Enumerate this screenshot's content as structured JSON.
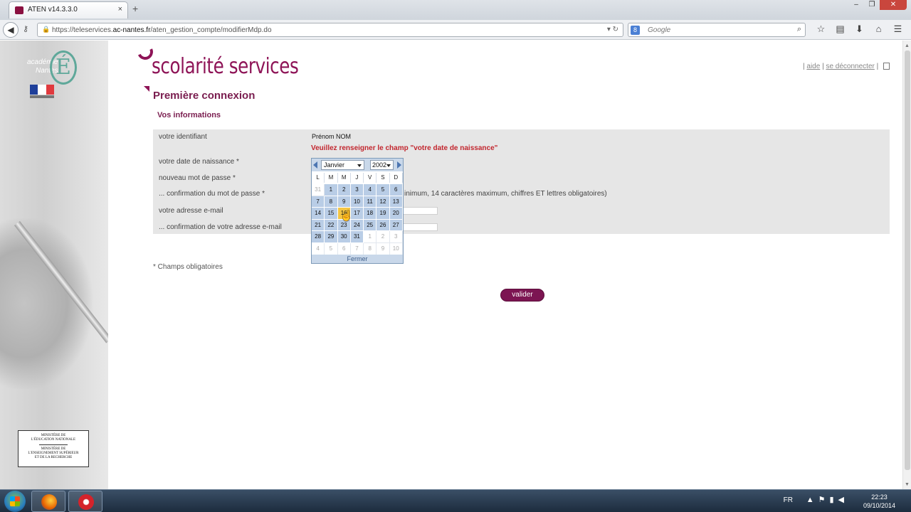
{
  "browser": {
    "tab_title": "ATEN v14.3.3.0",
    "tab_close": "×",
    "new_tab": "+",
    "url_prefix": "https://teleservices.",
    "url_domain": "ac-nantes.fr",
    "url_path": "/aten_gestion_compte/modifierMdp.do",
    "search_placeholder": "Google",
    "search_engine_letter": "8"
  },
  "sidebar": {
    "academie_line1": "académie",
    "academie_line2": "Nantes",
    "academie_letter": "É",
    "ministere_line1": "MINISTÈRE DE",
    "ministere_line2": "L'ÉDUCATION NATIONALE",
    "ministere_line3": "MINISTÈRE DE",
    "ministere_line4": "L'ENSEIGNEMENT SUPÉRIEUR",
    "ministere_line5": "ET DE LA RECHERCHE"
  },
  "header": {
    "logo_text": "scolarité services",
    "link_aide": "aide",
    "link_deconnecter": "se déconnecter"
  },
  "page": {
    "title": "Première connexion",
    "section_title": "Vos informations",
    "required_note": "* Champs obligatoires",
    "submit_label": "valider"
  },
  "form": {
    "identifiant_label": "votre identifiant",
    "identifiant_value": "Prénom NOM",
    "error_message": "Veuillez renseigner le champ \"votre date de naissance\"",
    "naissance_label": "votre date de naissance *",
    "mdp_label": "nouveau mot de passe *",
    "mdp_confirm_label": "... confirmation du mot de passe *",
    "mdp_hint": "inimum, 14 caractères maximum, chiffres ET lettres obligatoires)",
    "email_label": "votre adresse e-mail",
    "email_confirm_label": "... confirmation de votre adresse e-mail"
  },
  "calendar": {
    "month": "Janvier",
    "year": "2002",
    "weekdays": [
      "L",
      "M",
      "M",
      "J",
      "V",
      "S",
      "D"
    ],
    "days": [
      "31",
      "1",
      "2",
      "3",
      "4",
      "5",
      "6",
      "7",
      "8",
      "9",
      "10",
      "11",
      "12",
      "13",
      "14",
      "15",
      "16",
      "17",
      "18",
      "19",
      "20",
      "21",
      "22",
      "23",
      "24",
      "25",
      "26",
      "27",
      "28",
      "29",
      "30",
      "31",
      "1",
      "2",
      "3",
      "4",
      "5",
      "6",
      "7",
      "8",
      "9",
      "10"
    ],
    "selected_day": "16",
    "close_label": "Fermer"
  },
  "taskbar": {
    "language": "FR",
    "time": "22:23",
    "date": "09/10/2014"
  },
  "colors": {
    "brand": "#8e1457",
    "error": "#c2262e",
    "calendar_day": "#b9cde6",
    "calendar_selected": "#f4c542"
  }
}
